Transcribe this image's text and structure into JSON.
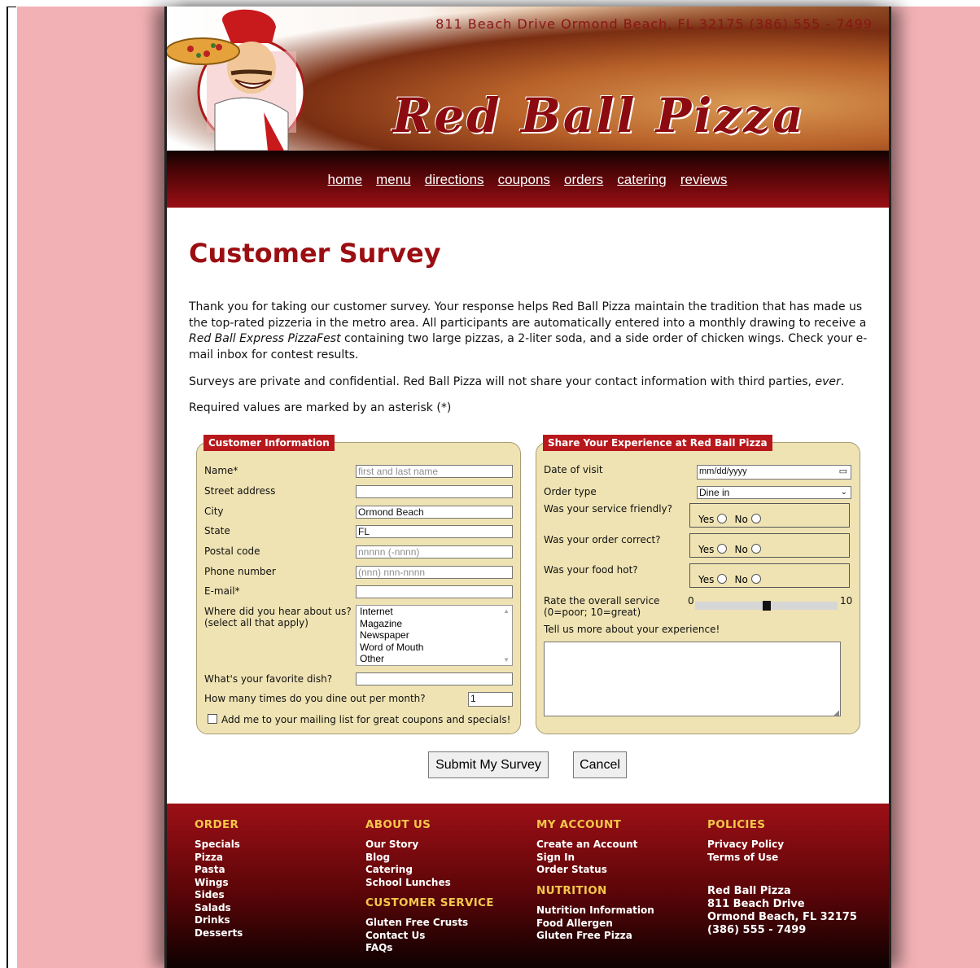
{
  "header": {
    "address": "811 Beach Drive  Ormond Beach, FL  32175   (386) 555 - 7499",
    "logo": "Red Ball Pizza"
  },
  "nav": {
    "items": [
      "home",
      "menu",
      "directions",
      "coupons",
      "orders",
      "catering",
      "reviews"
    ]
  },
  "main": {
    "title": "Customer Survey",
    "intro_1": "Thank you for taking our customer survey. Your response helps Red Ball Pizza maintain the tradition that has made us the top-rated pizzeria in the metro area. All participants are automatically entered into a monthly drawing to receive a ",
    "intro_em": "Red Ball Express PizzaFest",
    "intro_2": " containing two large pizzas, a 2-liter soda, and a side order of chicken wings. Check your e-mail inbox for contest results.",
    "privacy_1": "Surveys are private and confidential. Red Ball Pizza will not share your contact information with third parties, ",
    "privacy_em": "ever",
    "privacy_2": ".",
    "required_note": "Required values are marked by an asterisk (*)"
  },
  "customer_info": {
    "legend": "Customer Information",
    "name_label": "Name*",
    "name_placeholder": "first and last name",
    "street_label": "Street address",
    "city_label": "City",
    "city_value": "Ormond Beach",
    "state_label": "State",
    "state_value": "FL",
    "postal_label": "Postal code",
    "postal_placeholder": "nnnnn (-nnnn)",
    "phone_label": "Phone number",
    "phone_placeholder": "(nnn) nnn-nnnn",
    "email_label": "E-mail*",
    "hear_label": "Where did you hear about us?",
    "hear_sub": "(select all that apply)",
    "hear_options": [
      "Internet",
      "Magazine",
      "Newspaper",
      "Word of Mouth",
      "Other"
    ],
    "dish_label": "What's your favorite dish?",
    "dine_label": "How many times do you dine out per month?",
    "dine_value": "1",
    "mailing_label": "Add me to your mailing list for great coupons and specials!"
  },
  "experience": {
    "legend": "Share Your Experience at Red Ball Pizza",
    "date_label": "Date of visit",
    "date_placeholder": "mm/dd/yyyy",
    "order_label": "Order type",
    "order_value": "Dine in",
    "friendly_label": "Was your service friendly?",
    "correct_label": "Was your order correct?",
    "hot_label": "Was your food hot?",
    "yes": "Yes",
    "no": "No",
    "rate_label": "Rate the overall service",
    "rate_sub": "(0=poor; 10=great)",
    "rate_min": "0",
    "rate_max": "10",
    "rate_value": 5,
    "more_label": "Tell us more about your experience!"
  },
  "buttons": {
    "submit": "Submit My Survey",
    "cancel": "Cancel"
  },
  "footer": {
    "order_head": "ORDER",
    "order_items": [
      "Specials",
      "Pizza",
      "Pasta",
      "Wings",
      "Sides",
      "Salads",
      "Drinks",
      "Desserts"
    ],
    "about_head": "ABOUT US",
    "about_items": [
      "Our Story",
      "Blog",
      "Catering",
      "School Lunches"
    ],
    "service_head": "CUSTOMER SERVICE",
    "service_items": [
      "Gluten Free Crusts",
      "Contact Us",
      "FAQs"
    ],
    "account_head": "MY ACCOUNT",
    "account_items": [
      "Create an Account",
      "Sign In",
      "Order Status"
    ],
    "nutrition_head": "NUTRITION",
    "nutrition_items": [
      "Nutrition Information",
      "Food Allergen",
      "Gluten Free Pizza"
    ],
    "policies_head": "POLICIES",
    "policies_items": [
      "Privacy Policy",
      "Terms of Use"
    ],
    "address_lines": [
      "Red Ball Pizza",
      "811 Beach Drive",
      "Ormond Beach, FL 32175",
      "(386) 555 - 7499"
    ]
  },
  "colors": {
    "accent": "#9b0e12",
    "fieldset_bg": "#efe3b3",
    "footer_heading": "#f5c64b",
    "page_bg": "#f2b1b5"
  }
}
